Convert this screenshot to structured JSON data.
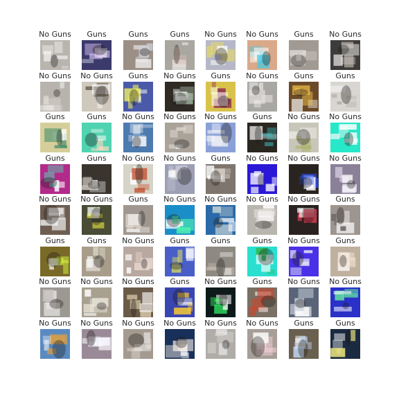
{
  "labels": [
    [
      "No Guns",
      "Guns",
      "Guns",
      "Guns",
      "No Guns",
      "No Guns",
      "Guns",
      "No Guns"
    ],
    [
      "No Guns",
      "No Guns",
      "Guns",
      "No Guns",
      "Guns",
      "No Guns",
      "Guns",
      "Guns"
    ],
    [
      "Guns",
      "Guns",
      "No Guns",
      "No Guns",
      "No Guns",
      "Guns",
      "No Guns",
      "No Guns"
    ],
    [
      "Guns",
      "Guns",
      "No Guns",
      "No Guns",
      "Guns",
      "No Guns",
      "No Guns",
      "No Guns"
    ],
    [
      "No Guns",
      "No Guns",
      "Guns",
      "No Guns",
      "No Guns",
      "No Guns",
      "No Guns",
      "Guns"
    ],
    [
      "Guns",
      "Guns",
      "No Guns",
      "Guns",
      "Guns",
      "Guns",
      "No Guns",
      "Guns"
    ],
    [
      "No Guns",
      "No Guns",
      "No Guns",
      "Guns",
      "No Guns",
      "Guns",
      "No Guns",
      "No Guns"
    ],
    [
      "No Guns",
      "No Guns",
      "No Guns",
      "No Guns",
      "No Guns",
      "No Guns",
      "Guns",
      "Guns"
    ]
  ],
  "thumb_colors": [
    [
      "#b9b4ae",
      "#3b3a6b",
      "#9b8f86",
      "#a9a7a0",
      "#b6b8c8",
      "#d9a98a",
      "#a09a93",
      "#3e3c3a"
    ],
    [
      "#b8b4ad",
      "#cfc8bc",
      "#4a5aa8",
      "#2f2a24",
      "#d8c24a",
      "#a8a7a4",
      "#6b4a2a",
      "#d9d6d2"
    ],
    [
      "#d6ce9a",
      "#4fd3b0",
      "#4d7bb0",
      "#a9a39a",
      "#8aa0d8",
      "#2a2620",
      "#c8c6b8",
      "#27e8c8"
    ],
    [
      "#b22a8a",
      "#3a342e",
      "#d6d3c7",
      "#9da0b4",
      "#7e756e",
      "#2a18d6",
      "#2a2420",
      "#8a8098"
    ],
    [
      "#6e5e52",
      "#4a4c36",
      "#a09890",
      "#1a8ec8",
      "#2a6aa8",
      "#b8b4ae",
      "#2a2220",
      "#9c9590"
    ],
    [
      "#7a6a28",
      "#a89c8a",
      "#b8a8a0",
      "#4a5ec8",
      "#8e8a82",
      "#2adfd0",
      "#4a30e6",
      "#bfb0a0"
    ],
    [
      "#9e9893",
      "#a8a090",
      "#6a5a48",
      "#3a46b0",
      "#0e1a1a",
      "#7a7064",
      "#5a6478",
      "#2a30c8"
    ],
    [
      "#5a8ac0",
      "#9a8a98",
      "#a49a90",
      "#18305a",
      "#b0aca8",
      "#a89e98",
      "#6a6050",
      "#1a2a40"
    ]
  ],
  "thumb_accents": [
    [
      "#e8e6e0",
      "#e8d0ff",
      "#d0d0d8",
      "#e0c0b8",
      "#f0e050",
      "#48c8e0",
      "#d8d0c8",
      "#d8d0c8"
    ],
    [
      "#e0dcd4",
      "#6a6050",
      "#f0f060",
      "#a8b8a8",
      "#8a2050",
      "#e8e4e0",
      "#f0c048",
      "#b0aca8"
    ],
    [
      "#3a8a6a",
      "#ffd8c0",
      "#e0e8f0",
      "#e0d8d0",
      "#f8f8f8",
      "#40c8c8",
      "#a8b060",
      "#f8f8f8"
    ],
    [
      "#40ffc0",
      "#d0c8c0",
      "#c04020",
      "#c8c8d8",
      "#d8d0c8",
      "#f8f8ff",
      "#2a50ff",
      "#f8f0ff"
    ],
    [
      "#f0f0f0",
      "#e0e040",
      "#e8e0d8",
      "#50f0b0",
      "#e8e8e0",
      "#e8e4e0",
      "#ff4060",
      "#6a6260"
    ],
    [
      "#d8f840",
      "#e0e0d0",
      "#e8d8d0",
      "#f0f050",
      "#c8c0b8",
      "#30b850",
      "#e8e8f8",
      "#f0e0d0"
    ],
    [
      "#c8c4c0",
      "#e8e4d8",
      "#e8d8b8",
      "#ffcc30",
      "#30e060",
      "#c84830",
      "#d0d8e0",
      "#60e0a0"
    ],
    [
      "#e0a040",
      "#f8f8ff",
      "#e0d8d0",
      "#f0e8e0",
      "#d8d4d0",
      "#ffd8e0",
      "#c8e0ff",
      "#f8f080"
    ]
  ]
}
